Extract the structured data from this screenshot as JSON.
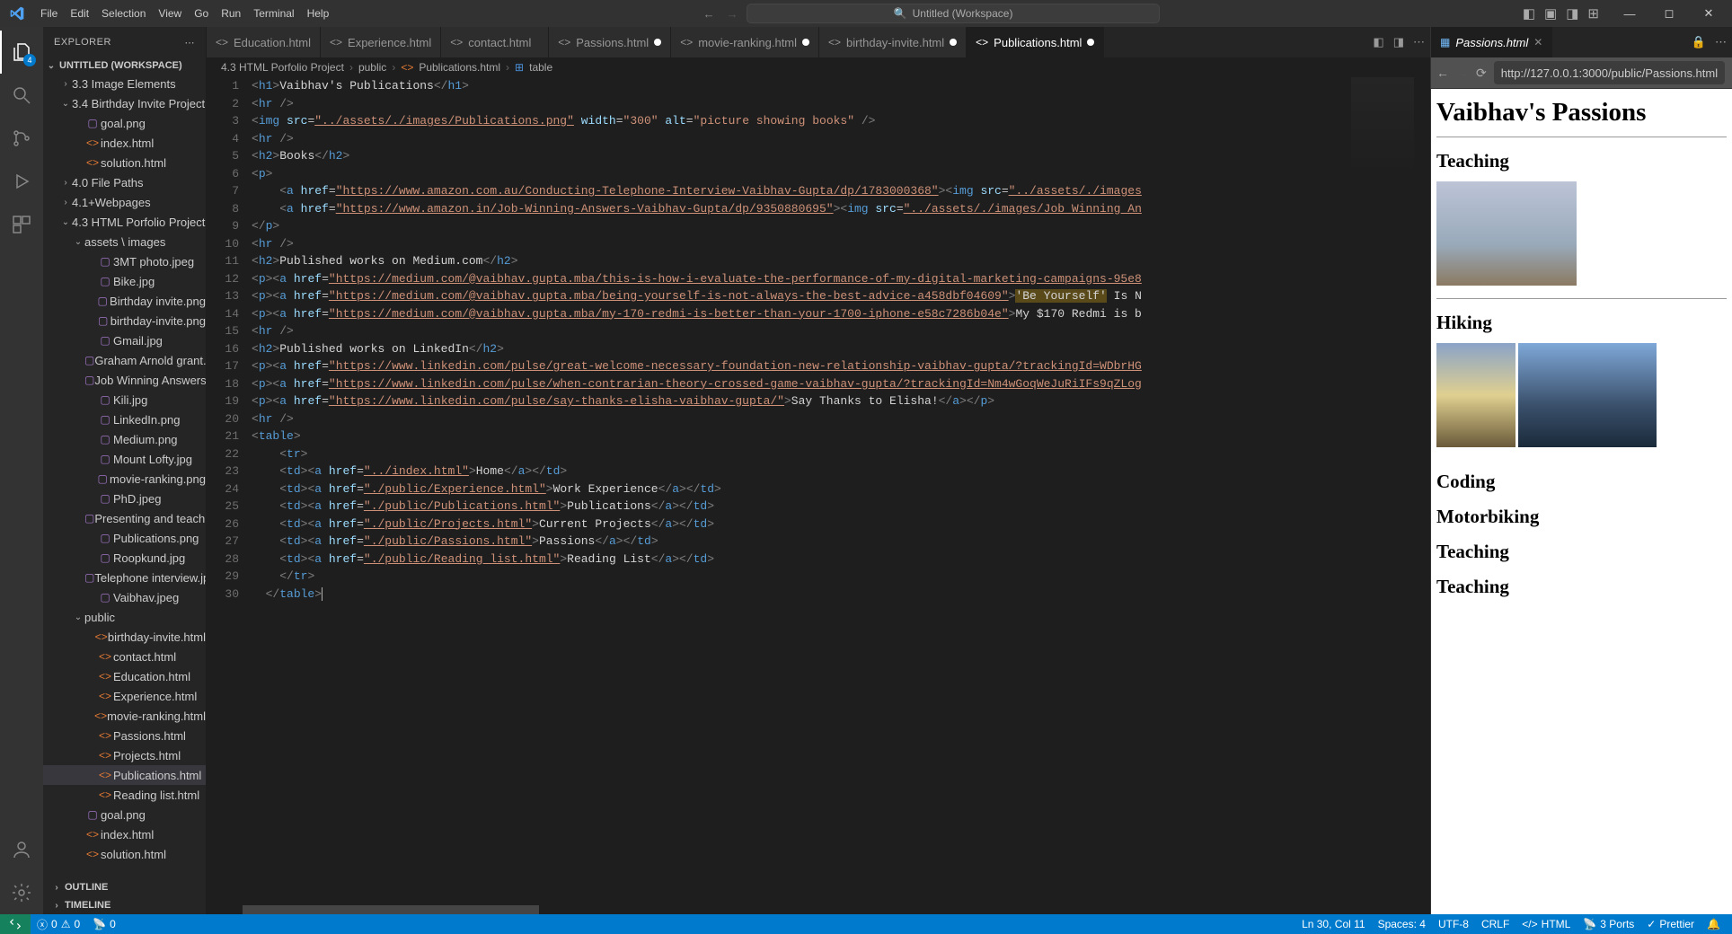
{
  "menubar": [
    "File",
    "Edit",
    "Selection",
    "View",
    "Go",
    "Run",
    "Terminal",
    "Help"
  ],
  "search_placeholder": "Untitled (Workspace)",
  "sidebar": {
    "title": "EXPLORER",
    "workspace": "UNTITLED (WORKSPACE)",
    "tree": [
      {
        "lvl": 1,
        "chev": "›",
        "label": "3.3 Image Elements",
        "type": "folder"
      },
      {
        "lvl": 1,
        "chev": "⌄",
        "label": "3.4 Birthday Invite Project",
        "type": "folder"
      },
      {
        "lvl": 2,
        "label": "goal.png",
        "type": "png"
      },
      {
        "lvl": 2,
        "label": "index.html",
        "type": "html"
      },
      {
        "lvl": 2,
        "label": "solution.html",
        "type": "html"
      },
      {
        "lvl": 1,
        "chev": "›",
        "label": "4.0 File Paths",
        "type": "folder"
      },
      {
        "lvl": 1,
        "chev": "›",
        "label": "4.1+Webpages",
        "type": "folder"
      },
      {
        "lvl": 1,
        "chev": "⌄",
        "label": "4.3 HTML Porfolio Project",
        "type": "folder"
      },
      {
        "lvl": 2,
        "chev": "⌄",
        "label": "assets \\ images",
        "type": "folder"
      },
      {
        "lvl": 3,
        "label": "3MT photo.jpeg",
        "type": "jpg"
      },
      {
        "lvl": 3,
        "label": "Bike.jpg",
        "type": "jpg"
      },
      {
        "lvl": 3,
        "label": "Birthday invite.png",
        "type": "png"
      },
      {
        "lvl": 3,
        "label": "birthday-invite.png",
        "type": "png"
      },
      {
        "lvl": 3,
        "label": "Gmail.jpg",
        "type": "jpg"
      },
      {
        "lvl": 3,
        "label": "Graham Arnold grant.jpeg",
        "type": "jpg"
      },
      {
        "lvl": 3,
        "label": "Job Winning Answers.jpeg",
        "type": "jpg"
      },
      {
        "lvl": 3,
        "label": "Kili.jpg",
        "type": "jpg"
      },
      {
        "lvl": 3,
        "label": "LinkedIn.png",
        "type": "png"
      },
      {
        "lvl": 3,
        "label": "Medium.png",
        "type": "png"
      },
      {
        "lvl": 3,
        "label": "Mount Lofty.jpg",
        "type": "jpg"
      },
      {
        "lvl": 3,
        "label": "movie-ranking.png",
        "type": "png"
      },
      {
        "lvl": 3,
        "label": "PhD.jpeg",
        "type": "jpg"
      },
      {
        "lvl": 3,
        "label": "Presenting and teaching.jpeg",
        "type": "jpg"
      },
      {
        "lvl": 3,
        "label": "Publications.png",
        "type": "png"
      },
      {
        "lvl": 3,
        "label": "Roopkund.jpg",
        "type": "jpg"
      },
      {
        "lvl": 3,
        "label": "Telephone interview.jpg",
        "type": "jpg"
      },
      {
        "lvl": 3,
        "label": "Vaibhav.jpeg",
        "type": "jpg"
      },
      {
        "lvl": 2,
        "chev": "⌄",
        "label": "public",
        "type": "folder"
      },
      {
        "lvl": 3,
        "label": "birthday-invite.html",
        "type": "html"
      },
      {
        "lvl": 3,
        "label": "contact.html",
        "type": "html"
      },
      {
        "lvl": 3,
        "label": "Education.html",
        "type": "html"
      },
      {
        "lvl": 3,
        "label": "Experience.html",
        "type": "html"
      },
      {
        "lvl": 3,
        "label": "movie-ranking.html",
        "type": "html"
      },
      {
        "lvl": 3,
        "label": "Passions.html",
        "type": "html"
      },
      {
        "lvl": 3,
        "label": "Projects.html",
        "type": "html"
      },
      {
        "lvl": 3,
        "label": "Publications.html",
        "type": "html",
        "selected": true
      },
      {
        "lvl": 3,
        "label": "Reading list.html",
        "type": "html"
      },
      {
        "lvl": 2,
        "label": "goal.png",
        "type": "png"
      },
      {
        "lvl": 2,
        "label": "index.html",
        "type": "html"
      },
      {
        "lvl": 2,
        "label": "solution.html",
        "type": "html"
      }
    ],
    "outline": "OUTLINE",
    "timeline": "TIMELINE"
  },
  "tabs": [
    {
      "label": "Education.html"
    },
    {
      "label": "Experience.html"
    },
    {
      "label": "contact.html"
    },
    {
      "label": "Passions.html",
      "dirty": true
    },
    {
      "label": "movie-ranking.html",
      "dirty": true
    },
    {
      "label": "birthday-invite.html",
      "dirty": true
    },
    {
      "label": "Publications.html",
      "dirty": true,
      "active": true
    }
  ],
  "breadcrumb": [
    "4.3 HTML Porfolio Project",
    "public",
    "Publications.html",
    "table"
  ],
  "code": [
    {
      "n": 1,
      "h": "<span class='punc'>&lt;</span><span class='tag'>h1</span><span class='punc'>&gt;</span><span class='text'>Vaibhav's Publications</span><span class='punc'>&lt;/</span><span class='tag'>h1</span><span class='punc'>&gt;</span>"
    },
    {
      "n": 2,
      "h": "<span class='punc'>&lt;</span><span class='tag'>hr</span> <span class='punc'>/&gt;</span>"
    },
    {
      "n": 3,
      "h": "<span class='punc'>&lt;</span><span class='tag'>img</span> <span class='attr'>src</span>=<span class='strv u'>\"../assets/./images/Publications.png\"</span> <span class='attr'>width</span>=<span class='strv'>\"300\"</span> <span class='attr'>alt</span>=<span class='strv'>\"picture showing books\"</span> <span class='punc'>/&gt;</span>"
    },
    {
      "n": 4,
      "h": "<span class='punc'>&lt;</span><span class='tag'>hr</span> <span class='punc'>/&gt;</span>"
    },
    {
      "n": 5,
      "h": "<span class='punc'>&lt;</span><span class='tag'>h2</span><span class='punc'>&gt;</span><span class='text'>Books</span><span class='punc'>&lt;/</span><span class='tag'>h2</span><span class='punc'>&gt;</span>"
    },
    {
      "n": 6,
      "h": "<span class='punc'>&lt;</span><span class='tag'>p</span><span class='punc'>&gt;</span>"
    },
    {
      "n": 7,
      "h": "    <span class='punc'>&lt;</span><span class='tag'>a</span> <span class='attr'>href</span>=<span class='strv u'>\"https://www.amazon.com.au/Conducting-Telephone-Interview-Vaibhav-Gupta/dp/1783000368\"</span><span class='punc'>&gt;&lt;</span><span class='tag'>img</span> <span class='attr'>src</span>=<span class='strv u'>\"../assets/./images</span>"
    },
    {
      "n": 8,
      "h": "    <span class='punc'>&lt;</span><span class='tag'>a</span> <span class='attr'>href</span>=<span class='strv u'>\"https://www.amazon.in/Job-Winning-Answers-Vaibhav-Gupta/dp/9350880695\"</span><span class='punc'>&gt;&lt;</span><span class='tag'>img</span> <span class='attr'>src</span>=<span class='strv u'>\"../assets/./images/Job Winning An</span>"
    },
    {
      "n": 9,
      "h": "<span class='punc'>&lt;/</span><span class='tag'>p</span><span class='punc'>&gt;</span>"
    },
    {
      "n": 10,
      "h": "<span class='punc'>&lt;</span><span class='tag'>hr</span> <span class='punc'>/&gt;</span>"
    },
    {
      "n": 11,
      "h": "<span class='punc'>&lt;</span><span class='tag'>h2</span><span class='punc'>&gt;</span><span class='text'>Published works on Medium.com</span><span class='punc'>&lt;/</span><span class='tag'>h2</span><span class='punc'>&gt;</span>"
    },
    {
      "n": 12,
      "h": "<span class='punc'>&lt;</span><span class='tag'>p</span><span class='punc'>&gt;&lt;</span><span class='tag'>a</span> <span class='attr'>href</span>=<span class='strv u'>\"https://medium.com/@vaibhav.gupta.mba/this-is-how-i-evaluate-the-performance-of-my-digital-marketing-campaigns-95e8</span>"
    },
    {
      "n": 13,
      "h": "<span class='punc'>&lt;</span><span class='tag'>p</span><span class='punc'>&gt;&lt;</span><span class='tag'>a</span> <span class='attr'>href</span>=<span class='strv u'>\"https://medium.com/@vaibhav.gupta.mba/being-yourself-is-not-always-the-best-advice-a458dbf04609\"</span><span class='punc'>&gt;</span><span class='text' style='background:#5a4a1a'>'Be Yourself'</span><span class='text'> Is N</span>"
    },
    {
      "n": 14,
      "h": "<span class='punc'>&lt;</span><span class='tag'>p</span><span class='punc'>&gt;&lt;</span><span class='tag'>a</span> <span class='attr'>href</span>=<span class='strv u'>\"https://medium.com/@vaibhav.gupta.mba/my-170-redmi-is-better-than-your-1700-iphone-e58c7286b04e\"</span><span class='punc'>&gt;</span><span class='text'>My $170 Redmi is b</span>"
    },
    {
      "n": 15,
      "h": "<span class='punc'>&lt;</span><span class='tag'>hr</span> <span class='punc'>/&gt;</span>"
    },
    {
      "n": 16,
      "h": "<span class='punc'>&lt;</span><span class='tag'>h2</span><span class='punc'>&gt;</span><span class='text'>Published works on LinkedIn</span><span class='punc'>&lt;/</span><span class='tag'>h2</span><span class='punc'>&gt;</span>"
    },
    {
      "n": 17,
      "h": "<span class='punc'>&lt;</span><span class='tag'>p</span><span class='punc'>&gt;&lt;</span><span class='tag'>a</span> <span class='attr'>href</span>=<span class='strv u'>\"https://www.linkedin.com/pulse/great-welcome-necessary-foundation-new-relationship-vaibhav-gupta/?trackingId=WDbrHG</span>"
    },
    {
      "n": 18,
      "h": "<span class='punc'>&lt;</span><span class='tag'>p</span><span class='punc'>&gt;&lt;</span><span class='tag'>a</span> <span class='attr'>href</span>=<span class='strv u'>\"https://www.linkedin.com/pulse/when-contrarian-theory-crossed-game-vaibhav-gupta/?trackingId=Nm4wGoqWeJuRiIFs9qZLog</span>"
    },
    {
      "n": 19,
      "h": "<span class='punc'>&lt;</span><span class='tag'>p</span><span class='punc'>&gt;&lt;</span><span class='tag'>a</span> <span class='attr'>href</span>=<span class='strv u'>\"https://www.linkedin.com/pulse/say-thanks-elisha-vaibhav-gupta/\"</span><span class='punc'>&gt;</span><span class='text'>Say Thanks to Elisha!</span><span class='punc'>&lt;/</span><span class='tag'>a</span><span class='punc'>&gt;&lt;/</span><span class='tag'>p</span><span class='punc'>&gt;</span>"
    },
    {
      "n": 20,
      "h": "<span class='punc'>&lt;</span><span class='tag'>hr</span> <span class='punc'>/&gt;</span>"
    },
    {
      "n": 21,
      "h": "<span class='punc'>&lt;</span><span class='tag'>table</span><span class='punc'>&gt;</span>"
    },
    {
      "n": 22,
      "h": "    <span class='punc'>&lt;</span><span class='tag'>tr</span><span class='punc'>&gt;</span>"
    },
    {
      "n": 23,
      "h": "    <span class='punc'>&lt;</span><span class='tag'>td</span><span class='punc'>&gt;&lt;</span><span class='tag'>a</span> <span class='attr'>href</span>=<span class='strv u'>\"../index.html\"</span><span class='punc'>&gt;</span><span class='text'>Home</span><span class='punc'>&lt;/</span><span class='tag'>a</span><span class='punc'>&gt;&lt;/</span><span class='tag'>td</span><span class='punc'>&gt;</span>"
    },
    {
      "n": 24,
      "h": "    <span class='punc'>&lt;</span><span class='tag'>td</span><span class='punc'>&gt;&lt;</span><span class='tag'>a</span> <span class='attr'>href</span>=<span class='strv u'>\"./public/Experience.html\"</span><span class='punc'>&gt;</span><span class='text'>Work Experience</span><span class='punc'>&lt;/</span><span class='tag'>a</span><span class='punc'>&gt;&lt;/</span><span class='tag'>td</span><span class='punc'>&gt;</span>"
    },
    {
      "n": 25,
      "h": "    <span class='punc'>&lt;</span><span class='tag'>td</span><span class='punc'>&gt;&lt;</span><span class='tag'>a</span> <span class='attr'>href</span>=<span class='strv u'>\"./public/Publications.html\"</span><span class='punc'>&gt;</span><span class='text'>Publications</span><span class='punc'>&lt;/</span><span class='tag'>a</span><span class='punc'>&gt;&lt;/</span><span class='tag'>td</span><span class='punc'>&gt;</span>"
    },
    {
      "n": 26,
      "h": "    <span class='punc'>&lt;</span><span class='tag'>td</span><span class='punc'>&gt;&lt;</span><span class='tag'>a</span> <span class='attr'>href</span>=<span class='strv u'>\"./public/Projects.html\"</span><span class='punc'>&gt;</span><span class='text'>Current Projects</span><span class='punc'>&lt;/</span><span class='tag'>a</span><span class='punc'>&gt;&lt;/</span><span class='tag'>td</span><span class='punc'>&gt;</span>"
    },
    {
      "n": 27,
      "h": "    <span class='punc'>&lt;</span><span class='tag'>td</span><span class='punc'>&gt;&lt;</span><span class='tag'>a</span> <span class='attr'>href</span>=<span class='strv u'>\"./public/Passions.html\"</span><span class='punc'>&gt;</span><span class='text'>Passions</span><span class='punc'>&lt;/</span><span class='tag'>a</span><span class='punc'>&gt;&lt;/</span><span class='tag'>td</span><span class='punc'>&gt;</span>"
    },
    {
      "n": 28,
      "h": "    <span class='punc'>&lt;</span><span class='tag'>td</span><span class='punc'>&gt;&lt;</span><span class='tag'>a</span> <span class='attr'>href</span>=<span class='strv u'>\"./public/Reading list.html\"</span><span class='punc'>&gt;</span><span class='text'>Reading List</span><span class='punc'>&lt;/</span><span class='tag'>a</span><span class='punc'>&gt;&lt;/</span><span class='tag'>td</span><span class='punc'>&gt;</span>"
    },
    {
      "n": 29,
      "h": "    <span class='punc'>&lt;/</span><span class='tag'>tr</span><span class='punc'>&gt;</span>"
    },
    {
      "n": 30,
      "h": "  <span class='punc'>&lt;/</span><span class='tag'>table</span><span class='punc'>&gt;</span><span style='border-left:1px solid #aeafad; height:15px;'></span>"
    }
  ],
  "preview": {
    "tab": "Passions.html",
    "url": "http://127.0.0.1:3000/public/Passions.html",
    "h1": "Vaibhav's Passions",
    "sections": [
      "Teaching",
      "Hiking",
      "Coding",
      "Motorbiking",
      "Teaching",
      "Teaching"
    ]
  },
  "statusbar": {
    "errors": "0",
    "warnings": "0",
    "ports_left": "0",
    "pos": "Ln 30, Col 11",
    "spaces": "Spaces: 4",
    "encoding": "UTF-8",
    "eol": "CRLF",
    "lang": "HTML",
    "ports": "3 Ports",
    "prettier": "Prettier"
  }
}
